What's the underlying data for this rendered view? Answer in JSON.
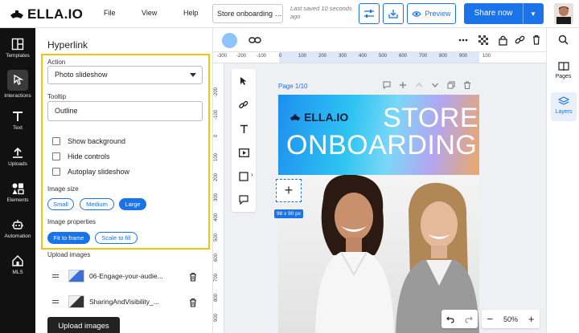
{
  "app": {
    "logo_text": "ELLA.IO",
    "menu": [
      "File",
      "View",
      "Help"
    ],
    "doc_name": "Store onboarding p...",
    "saved_text": "Last saved 10 seconds ago",
    "preview_label": "Preview",
    "share_label": "Share now"
  },
  "rail": {
    "items": [
      {
        "label": "Templates",
        "icon": "templates-icon"
      },
      {
        "label": "Interactions",
        "icon": "interactions-icon"
      },
      {
        "label": "Text",
        "icon": "text-icon"
      },
      {
        "label": "Uploads",
        "icon": "uploads-icon"
      },
      {
        "label": "Elements",
        "icon": "elements-icon"
      },
      {
        "label": "Automation",
        "icon": "automation-icon"
      },
      {
        "label": "MLS",
        "icon": "mls-icon"
      }
    ]
  },
  "panel": {
    "title": "Hyperlink",
    "action_label": "Action",
    "action_value": "Photo slideshow",
    "tooltip_label": "Tooltip",
    "tooltip_value": "Outline",
    "checkboxes": [
      "Show background",
      "Hide controls",
      "Autoplay slideshow"
    ],
    "image_size_label": "Image size",
    "sizes": [
      "Small",
      "Medium",
      "Large"
    ],
    "selected_size": "Large",
    "image_properties_label": "Image properties",
    "properties": [
      "Fit to frame",
      "Scale to fill"
    ],
    "selected_property": "Fit to frame",
    "upload_images_label": "Upload images",
    "uploads": [
      "06-Engage-your-audie...",
      "SharingAndVisibility_..."
    ],
    "upload_button": "Upload images"
  },
  "canvas": {
    "ruler_ticks": [
      "-300",
      "-200",
      "-100",
      "0",
      "100",
      "200",
      "300",
      "400",
      "500",
      "600",
      "700",
      "800",
      "900",
      "100"
    ],
    "page_label": "Page 1/10",
    "banner_logo": "ELLA.IO",
    "banner_line1": "STORE",
    "banner_line2": "ONBOARDING",
    "selection_size": "98 x 90 px",
    "zoom": "50%",
    "accent": "#1a73e8"
  },
  "right_rail": {
    "items": [
      {
        "label": "Pages",
        "icon": "pages-icon"
      },
      {
        "label": "Layers",
        "icon": "layers-icon"
      }
    ]
  }
}
